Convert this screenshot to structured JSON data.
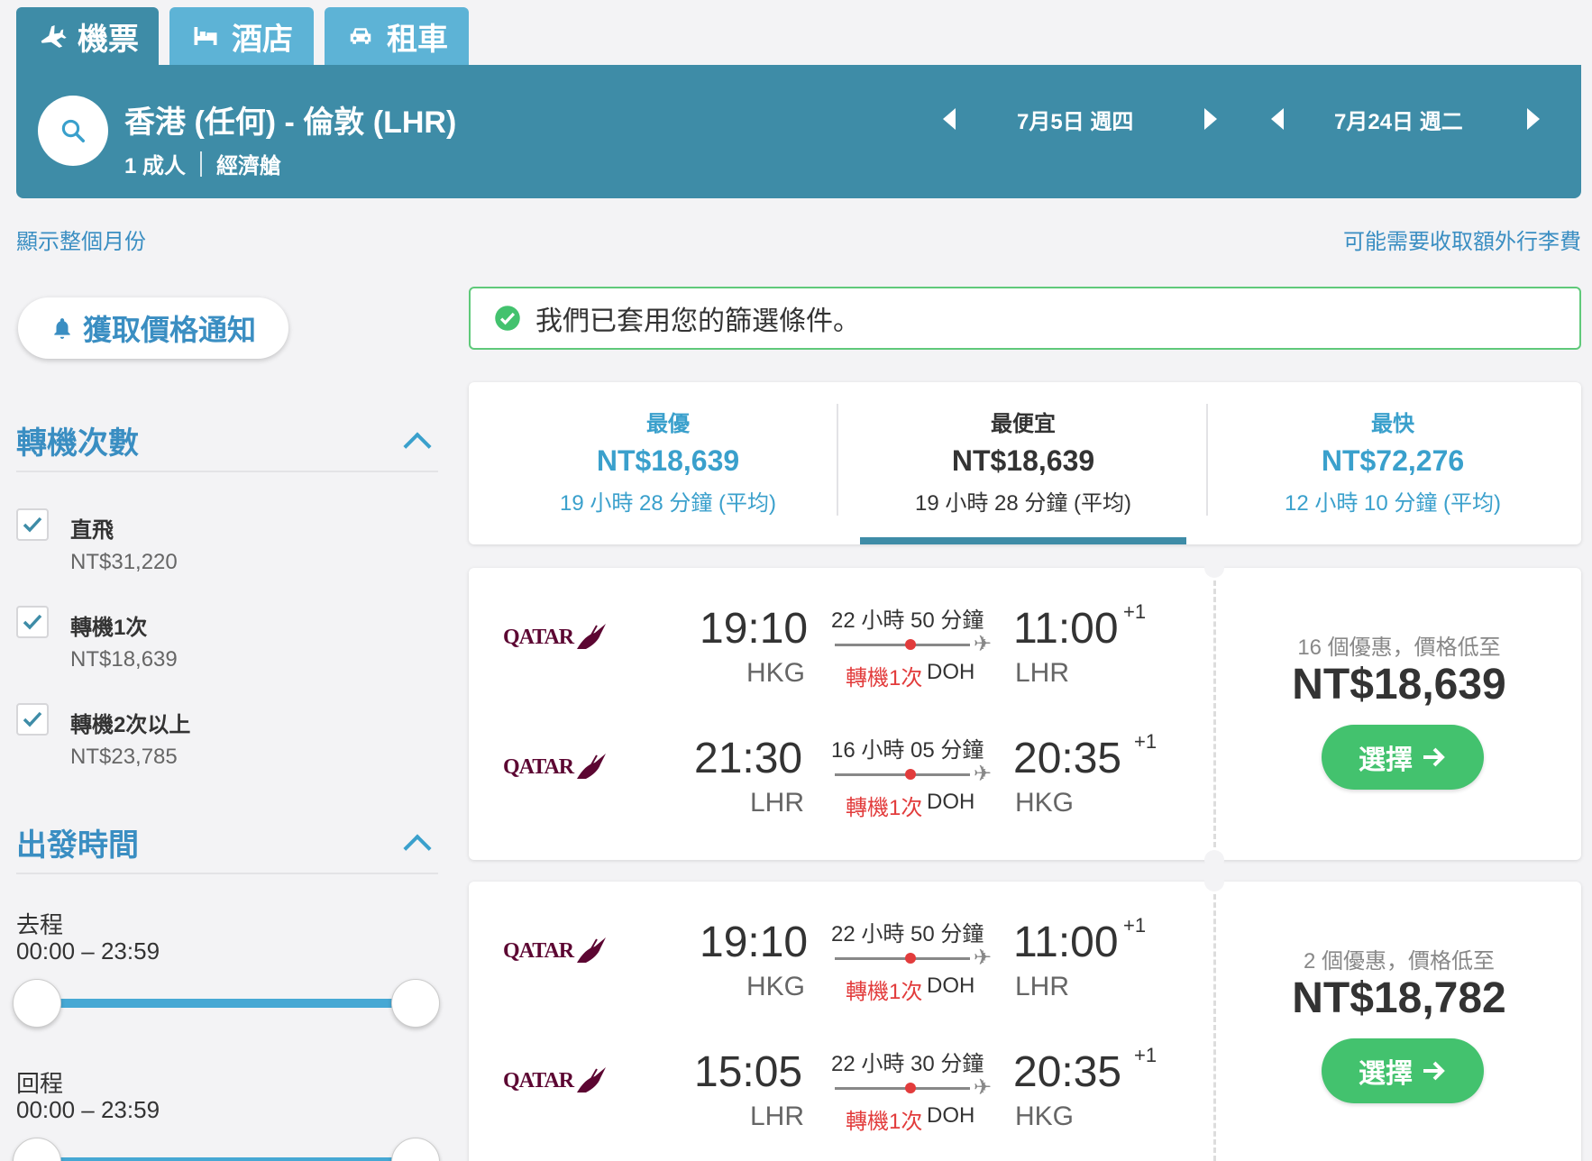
{
  "tabs": [
    {
      "label": "機票",
      "icon": "plane-icon"
    },
    {
      "label": "酒店",
      "icon": "bed-icon"
    },
    {
      "label": "租車",
      "icon": "car-icon"
    }
  ],
  "search": {
    "route": "香港 (任何) - 倫敦 (LHR)",
    "passengers": "1 成人",
    "cabin": "經濟艙",
    "depart_date": "7月5日 週四",
    "return_date": "7月24日 週二"
  },
  "links": {
    "show_month": "顯示整個月份",
    "baggage_fee": "可能需要收取額外行李費"
  },
  "price_alert": "獲取價格通知",
  "notice": "我們已套用您的篩選條件。",
  "filters": {
    "stops_title": "轉機次數",
    "stops": [
      {
        "label": "直飛",
        "price": "NT$31,220",
        "checked": true
      },
      {
        "label": "轉機1次",
        "price": "NT$18,639",
        "checked": true
      },
      {
        "label": "轉機2次以上",
        "price": "NT$23,785",
        "checked": true
      }
    ],
    "time_title": "出發時間",
    "outbound_label": "去程",
    "outbound_range": "00:00 – 23:59",
    "return_label": "回程",
    "return_range": "00:00 – 23:59"
  },
  "sort": [
    {
      "title": "最優",
      "price": "NT$18,639",
      "duration": "19 小時 28 分鐘 (平均)"
    },
    {
      "title": "最便宜",
      "price": "NT$18,639",
      "duration": "19 小時 28 分鐘 (平均)"
    },
    {
      "title": "最快",
      "price": "NT$72,276",
      "duration": "12 小時 10 分鐘 (平均)"
    }
  ],
  "results": [
    {
      "deals": "16 個優惠，價格低至",
      "price": "NT$18,639",
      "select": "選擇",
      "legs": [
        {
          "airline": "QATAR",
          "dep_time": "19:10",
          "dep_code": "HKG",
          "duration": "22 小時 50 分鐘",
          "stops": "轉機1次",
          "via": "DOH",
          "arr_time": "11:00",
          "plus": "+1",
          "arr_code": "LHR"
        },
        {
          "airline": "QATAR",
          "dep_time": "21:30",
          "dep_code": "LHR",
          "duration": "16 小時 05 分鐘",
          "stops": "轉機1次",
          "via": "DOH",
          "arr_time": "20:35",
          "plus": "+1",
          "arr_code": "HKG"
        }
      ]
    },
    {
      "deals": "2 個優惠，價格低至",
      "price": "NT$18,782",
      "select": "選擇",
      "legs": [
        {
          "airline": "QATAR",
          "dep_time": "19:10",
          "dep_code": "HKG",
          "duration": "22 小時 50 分鐘",
          "stops": "轉機1次",
          "via": "DOH",
          "arr_time": "11:00",
          "plus": "+1",
          "arr_code": "LHR"
        },
        {
          "airline": "QATAR",
          "dep_time": "15:05",
          "dep_code": "LHR",
          "duration": "22 小時 30 分鐘",
          "stops": "轉機1次",
          "via": "DOH",
          "arr_time": "20:35",
          "plus": "+1",
          "arr_code": "HKG"
        }
      ]
    }
  ],
  "colors": {
    "primary": "#3e8ca7",
    "tab_inactive": "#5db3d6",
    "accent_blue": "#3aa0cc",
    "select_green": "#43c26e",
    "stop_red": "#e23c3c"
  }
}
